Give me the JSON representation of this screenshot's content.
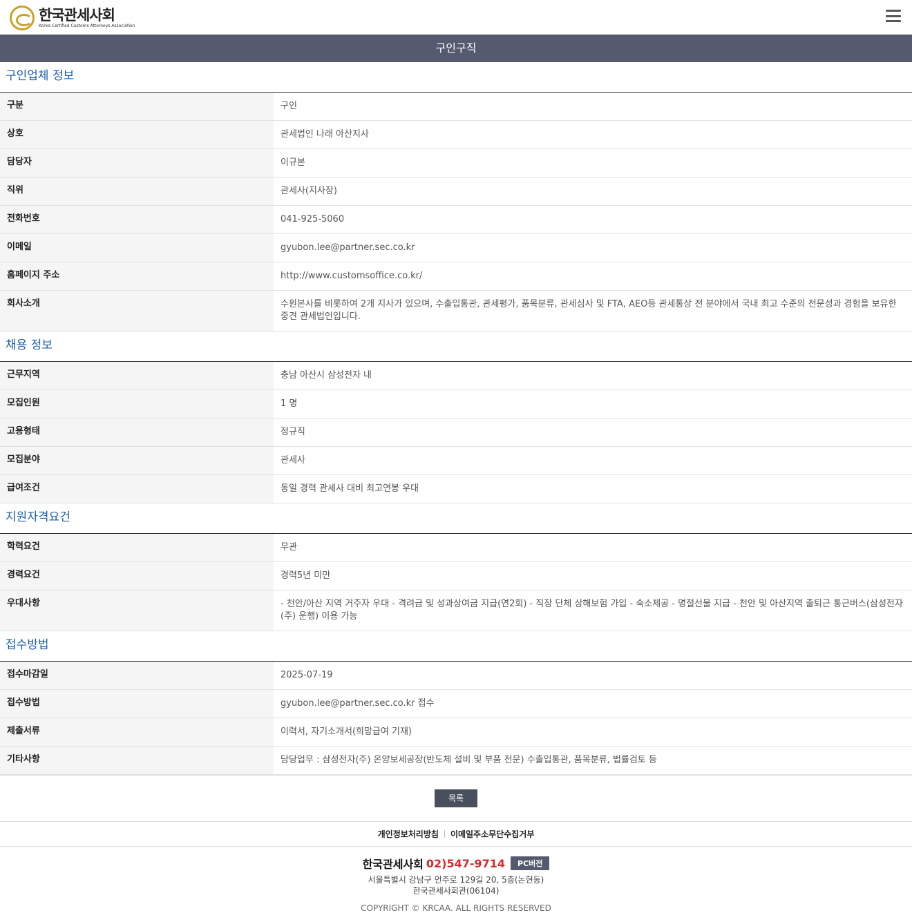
{
  "header": {
    "logo_title": "한국관세사회",
    "logo_sub": "Korea Certified Customs Attorneys Association"
  },
  "page_title": "구인구직",
  "sections": {
    "company": {
      "title": "구인업체 정보",
      "rows": [
        {
          "label": "구분",
          "value": "구인"
        },
        {
          "label": "상호",
          "value": "관세법인 나래 아산지사"
        },
        {
          "label": "담당자",
          "value": "이규본"
        },
        {
          "label": "직위",
          "value": "관세사(지사장)"
        },
        {
          "label": "전화번호",
          "value": "041-925-5060"
        },
        {
          "label": "이메일",
          "value": "gyubon.lee@partner.sec.co.kr"
        },
        {
          "label": "홈페이지 주소",
          "value": "http://www.customsoffice.co.kr/"
        },
        {
          "label": "회사소개",
          "value": "수원본사를 비롯하여 2개 지사가 있으며, 수출입통관, 관세평가, 품목분류, 관세심사 및 FTA, AEO등 관세통상 전 분야에서 국내 최고 수준의 전문성과 경험을 보유한 중견 관세법인입니다."
        }
      ]
    },
    "recruit": {
      "title": "채용 정보",
      "rows": [
        {
          "label": "근무지역",
          "value": "충남 아산시 삼성전자 내"
        },
        {
          "label": "모집인원",
          "value": "1 명"
        },
        {
          "label": "고용형태",
          "value": "정규직"
        },
        {
          "label": "모집분야",
          "value": "관세사"
        },
        {
          "label": "급여조건",
          "value": "동일 경력 관세사 대비 최고연봉 우대"
        }
      ]
    },
    "qualification": {
      "title": "지원자격요건",
      "rows": [
        {
          "label": "학력요건",
          "value": "무관"
        },
        {
          "label": "경력요건",
          "value": "경력5년 미만"
        },
        {
          "label": "우대사항",
          "value": "- 천안/아산 지역 거주자 우대 - 격려금 및 성과상여금 지급(연2회) - 직장 단체 상해보험 가입 - 숙소제공 - 명절선물 지급 - 천안 및 아산지역 출퇴근 통근버스(삼성전자(주) 운행) 이용 가능"
        }
      ]
    },
    "apply": {
      "title": "접수방법",
      "rows": [
        {
          "label": "접수마감일",
          "value": "2025-07-19"
        },
        {
          "label": "접수방법",
          "value": "gyubon.lee@partner.sec.co.kr 접수"
        },
        {
          "label": "제출서류",
          "value": "이력서, 자기소개서(희망급여 기재)"
        },
        {
          "label": "기타사항",
          "value": "담당업무 : 삼성전자(주) 온양보세공장(반도체 설비 및 부품 전문) 수출입통관, 품목분류, 법률검토 등"
        }
      ]
    }
  },
  "list_button": "목록",
  "footer": {
    "link_privacy": "개인정보처리방침",
    "link_email": "이메일주소무단수집거부",
    "org": "한국관세사회",
    "phone": "02)547-9714",
    "pc_label": "PC버전",
    "address1": "서울특별시 강남구 언주로 129길 20, 5층(논현동)",
    "address2": "한국관세사회관(06104)",
    "copyright": "COPYRIGHT © KRCAA. ALL RIGHTS RESERVED"
  },
  "colors": {
    "title_bar": "#555a6e",
    "section_title": "#1a5fa8",
    "phone": "#d7292b",
    "logo_gold": "#c9a227"
  }
}
